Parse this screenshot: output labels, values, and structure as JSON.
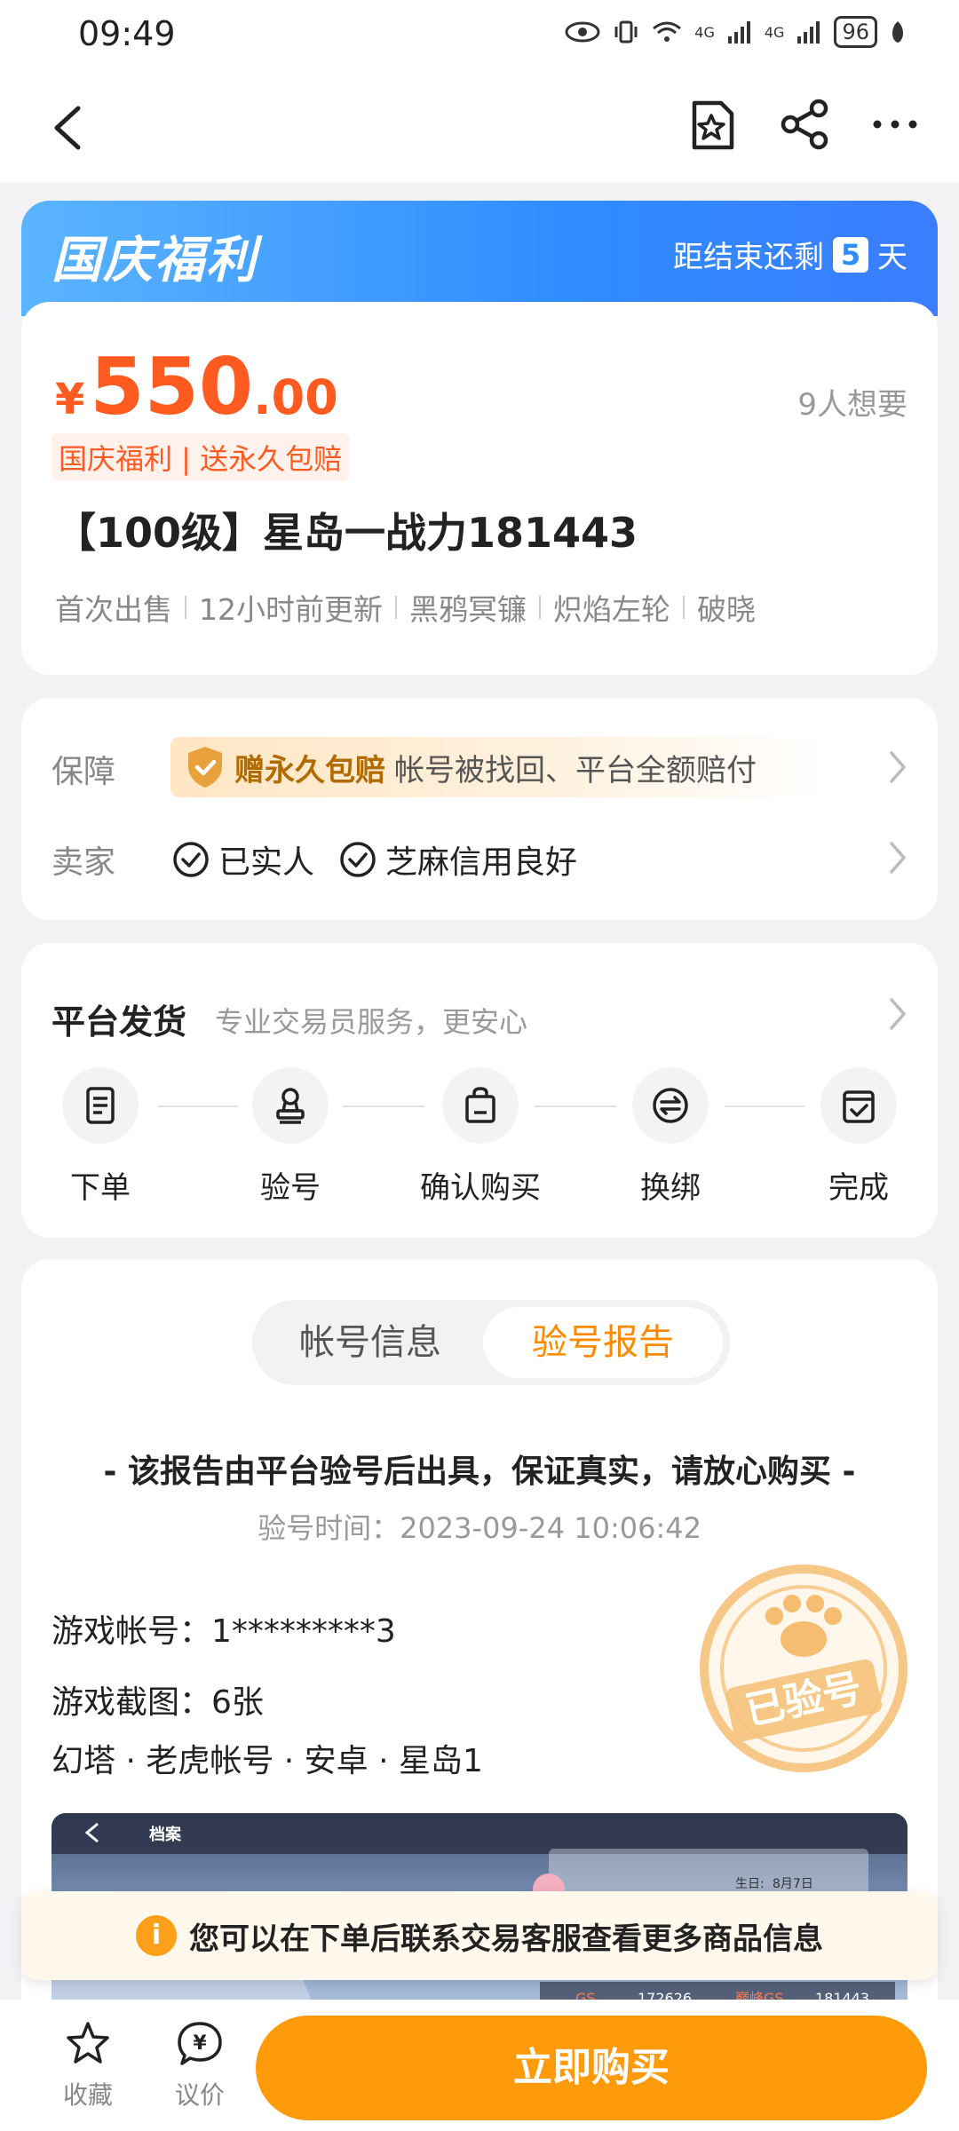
{
  "status_bar": {
    "time": "09:49",
    "network_1": "4G",
    "network_2": "4G",
    "battery": "96"
  },
  "promo": {
    "title": "国庆福利",
    "countdown_prefix": "距结束还剩",
    "countdown_days": "5",
    "countdown_suffix": "天",
    "colors": {
      "start": "#5bb4ff",
      "end": "#3a7dff"
    }
  },
  "product": {
    "currency": "¥",
    "price_int": "550",
    "price_dec": ".00",
    "wants": "9人想要",
    "promo_tag": "国庆福利 | 送永久包赔",
    "title": "【100级】星岛一战力181443",
    "tags": [
      "首次出售",
      "12小时前更新",
      "黑鸦冥镰",
      "炽焰左轮",
      "破晓"
    ],
    "price_color": "#ff5a1f"
  },
  "guarantee": {
    "label": "保障",
    "strong": "赠永久包赔",
    "desc": "帐号被找回、平台全额赔付"
  },
  "seller": {
    "label": "卖家",
    "items": [
      "已实人",
      "芝麻信用良好"
    ]
  },
  "delivery": {
    "title": "平台发货",
    "subtitle": "专业交易员服务，更安心",
    "steps": [
      {
        "label": "下单",
        "icon": "document-icon"
      },
      {
        "label": "验号",
        "icon": "stamp-icon"
      },
      {
        "label": "确认购买",
        "icon": "bag-icon"
      },
      {
        "label": "换绑",
        "icon": "swap-icon"
      },
      {
        "label": "完成",
        "icon": "check-box-icon"
      }
    ]
  },
  "report": {
    "tabs": [
      "帐号信息",
      "验号报告"
    ],
    "active_tab": "验号报告",
    "headline": "- 该报告由平台验号后出具，保证真实，请放心购买 -",
    "time_label": "验号时间：",
    "time_value": "2023-09-24 10:06:42",
    "account_label": "游戏帐号：",
    "account_value": "1*********3",
    "screenshots_label": "游戏截图：",
    "screenshots_value": "6张",
    "meta": "幻塔 · 老虎帐号 · 安卓 · 星岛1",
    "stamp_text": "已验号",
    "screenshot_texts": {
      "tab": "档案",
      "birthday_label": "生日:",
      "birthday": "8月7日",
      "gs_label": "GS",
      "gs_value": "172626",
      "peak_label": "巅峰GS",
      "peak_value": "181443"
    }
  },
  "hint": {
    "icon": "i",
    "text": "您可以在下单后联系交易客服查看更多商品信息"
  },
  "bottom_bar": {
    "favorite_label": "收藏",
    "negotiate_label": "议价",
    "buy_label": "立即购买",
    "accent": "#ff9a0a"
  }
}
